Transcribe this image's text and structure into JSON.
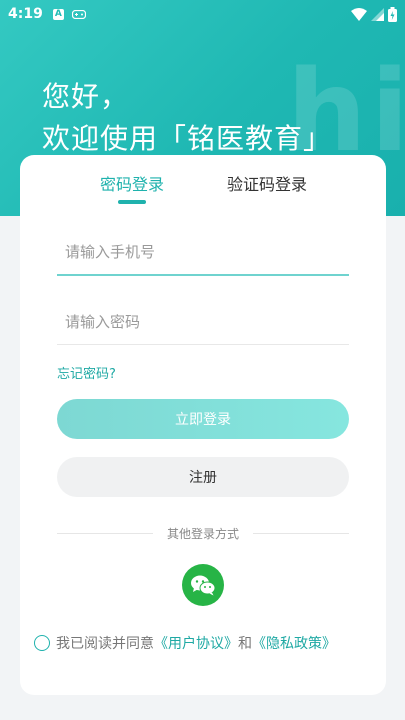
{
  "status": {
    "time": "4:19",
    "notif_letter": "A"
  },
  "hero": {
    "watermark": "hi",
    "greeting_line1": "您好，",
    "greeting_line2": "欢迎使用「铭医教育」"
  },
  "tabs": [
    {
      "label": "密码登录",
      "active": true
    },
    {
      "label": "验证码登录",
      "active": false
    }
  ],
  "form": {
    "phone_placeholder": "请输入手机号",
    "password_placeholder": "请输入密码",
    "forgot_label": "忘记密码?",
    "login_label": "立即登录",
    "register_label": "注册"
  },
  "other_login": {
    "label": "其他登录方式",
    "icons": [
      "wechat-icon"
    ]
  },
  "agreement": {
    "prefix": "我已阅读并同意",
    "user_agreement": "《用户协议》",
    "and": "和",
    "privacy_policy": "《隐私政策》"
  },
  "colors": {
    "accent": "#1fb2ad",
    "hero_start": "#34c9c2",
    "hero_end": "#19b0ad",
    "wechat": "#27b446"
  }
}
